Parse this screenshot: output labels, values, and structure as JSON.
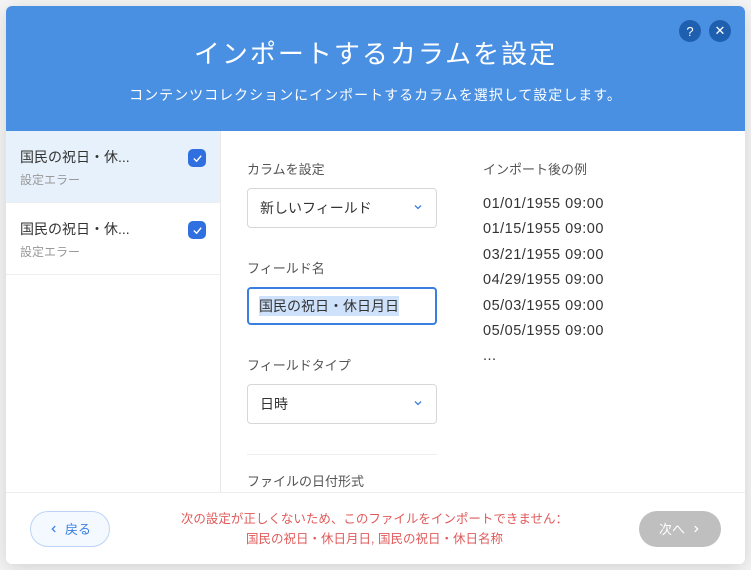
{
  "header": {
    "title": "インポートするカラムを設定",
    "subtitle": "コンテンツコレクションにインポートするカラムを選択して設定します。",
    "help_icon": "?",
    "close_icon": "✕"
  },
  "sidebar": {
    "items": [
      {
        "title": "国民の祝日・休...",
        "sub": "設定エラー",
        "checked": true,
        "active": true
      },
      {
        "title": "国民の祝日・休...",
        "sub": "設定エラー",
        "checked": true,
        "active": false
      }
    ]
  },
  "form": {
    "column_label": "カラムを設定",
    "column_value": "新しいフィールド",
    "field_name_label": "フィールド名",
    "field_name_value": "国民の祝日・休日月日",
    "field_type_label": "フィールドタイプ",
    "field_type_value": "日時",
    "date_format_label": "ファイルの日付形式"
  },
  "preview": {
    "label": "インポート後の例",
    "rows": [
      "01/01/1955 09:00",
      "01/15/1955 09:00",
      "03/21/1955 09:00",
      "04/29/1955 09:00",
      "05/03/1955 09:00",
      "05/05/1955 09:00",
      "..."
    ]
  },
  "footer": {
    "back": "戻る",
    "error_line1": "次の設定が正しくないため、このファイルをインポートできません：",
    "error_line2": "国民の祝日・休日月日, 国民の祝日・休日名称",
    "next": "次へ"
  }
}
